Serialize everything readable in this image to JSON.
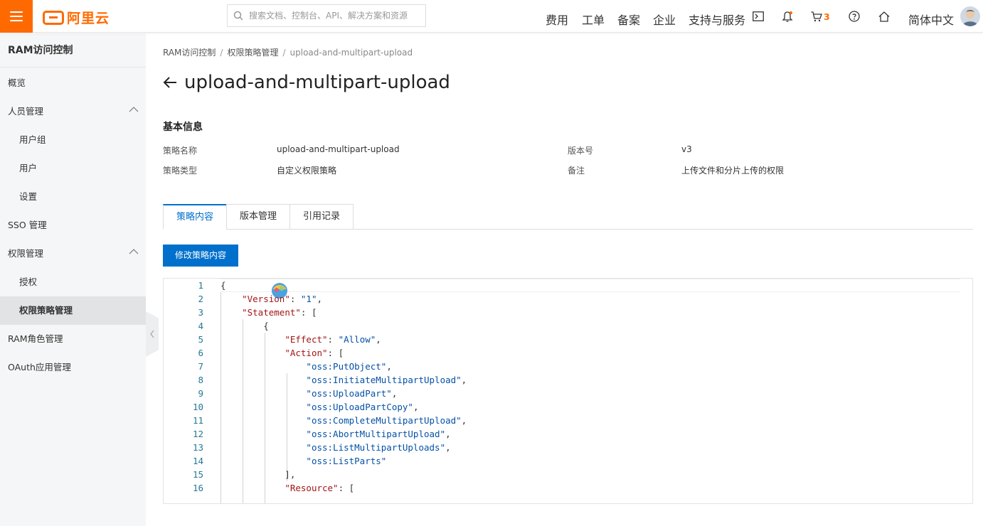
{
  "topbar": {
    "logo_text": "阿里云",
    "search_placeholder": "搜索文档、控制台、API、解决方案和资源",
    "nav": [
      "费用",
      "工单",
      "备案",
      "企业",
      "支持与服务"
    ],
    "cart_count": "3",
    "language": "简体中文",
    "accent": "#ff6a00"
  },
  "sidebar": {
    "title": "RAM访问控制",
    "items": [
      {
        "label": "概览"
      },
      {
        "label": "人员管理"
      },
      {
        "label": "用户组"
      },
      {
        "label": "用户"
      },
      {
        "label": "设置"
      },
      {
        "label": "SSO 管理"
      },
      {
        "label": "权限管理"
      },
      {
        "label": "授权"
      },
      {
        "label": "权限策略管理"
      },
      {
        "label": "RAM角色管理"
      },
      {
        "label": "OAuth应用管理"
      }
    ]
  },
  "breadcrumb": [
    "RAM访问控制",
    "权限策略管理",
    "upload-and-multipart-upload"
  ],
  "page": {
    "title": "upload-and-multipart-upload",
    "section_title": "基本信息",
    "fields": {
      "name_label": "策略名称",
      "name_value": "upload-and-multipart-upload",
      "type_label": "策略类型",
      "type_value": "自定义权限策略",
      "version_label": "版本号",
      "version_value": "v3",
      "note_label": "备注",
      "note_value": "上传文件和分片上传的权限"
    },
    "tabs": [
      "策略内容",
      "版本管理",
      "引用记录"
    ],
    "edit_button": "修改策略内容",
    "primary_color": "#0070cc"
  },
  "editor": {
    "line_numbers": [
      "1",
      "2",
      "3",
      "4",
      "5",
      "6",
      "7",
      "8",
      "9",
      "10",
      "11",
      "12",
      "13",
      "14",
      "15",
      "16"
    ],
    "lines": [
      "{",
      "    \"Version\": \"1\",",
      "    \"Statement\": [",
      "        {",
      "            \"Effect\": \"Allow\",",
      "            \"Action\": [",
      "                \"oss:PutObject\",",
      "                \"oss:InitiateMultipartUpload\",",
      "                \"oss:UploadPart\",",
      "                \"oss:UploadPartCopy\",",
      "                \"oss:CompleteMultipartUpload\",",
      "                \"oss:AbortMultipartUpload\",",
      "                \"oss:ListMultipartUploads\",",
      "                \"oss:ListParts\"",
      "            ],",
      "            \"Resource\": ["
    ]
  }
}
